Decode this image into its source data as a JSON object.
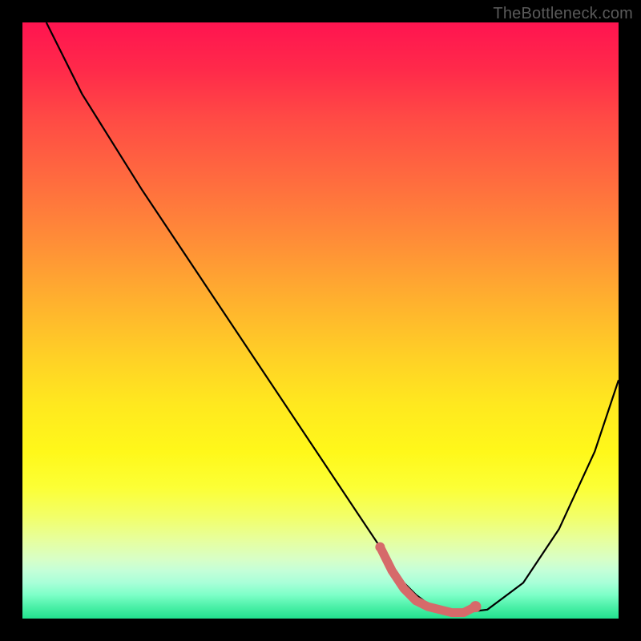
{
  "watermark": "TheBottleneck.com",
  "chart_data": {
    "type": "line",
    "title": "",
    "xlabel": "",
    "ylabel": "",
    "xlim": [
      0,
      100
    ],
    "ylim": [
      0,
      100
    ],
    "grid": false,
    "legend": false,
    "series": [
      {
        "name": "bottleneck-curve",
        "color": "#000000",
        "x": [
          4,
          10,
          20,
          30,
          40,
          50,
          56,
          60,
          62,
          64,
          66,
          68,
          70,
          72,
          74,
          78,
          84,
          90,
          96,
          100
        ],
        "y": [
          100,
          88,
          72,
          57,
          42,
          27,
          18,
          12,
          9,
          6,
          4,
          2.5,
          1.5,
          1,
          1,
          1.5,
          6,
          15,
          28,
          40
        ]
      }
    ],
    "highlight_region": {
      "name": "optimal-flat-region",
      "color": "#d66a6a",
      "x": [
        60,
        62,
        64,
        66,
        68,
        70,
        72,
        74,
        76
      ],
      "y": [
        12,
        8,
        5,
        3,
        2,
        1.5,
        1,
        1,
        2
      ]
    },
    "gradient_stops": [
      {
        "pos": 0,
        "color": "#ff1450"
      },
      {
        "pos": 26,
        "color": "#ff6a3f"
      },
      {
        "pos": 56,
        "color": "#ffd026"
      },
      {
        "pos": 78,
        "color": "#fcff35"
      },
      {
        "pos": 92,
        "color": "#c4ffd8"
      },
      {
        "pos": 100,
        "color": "#22e28e"
      }
    ]
  }
}
